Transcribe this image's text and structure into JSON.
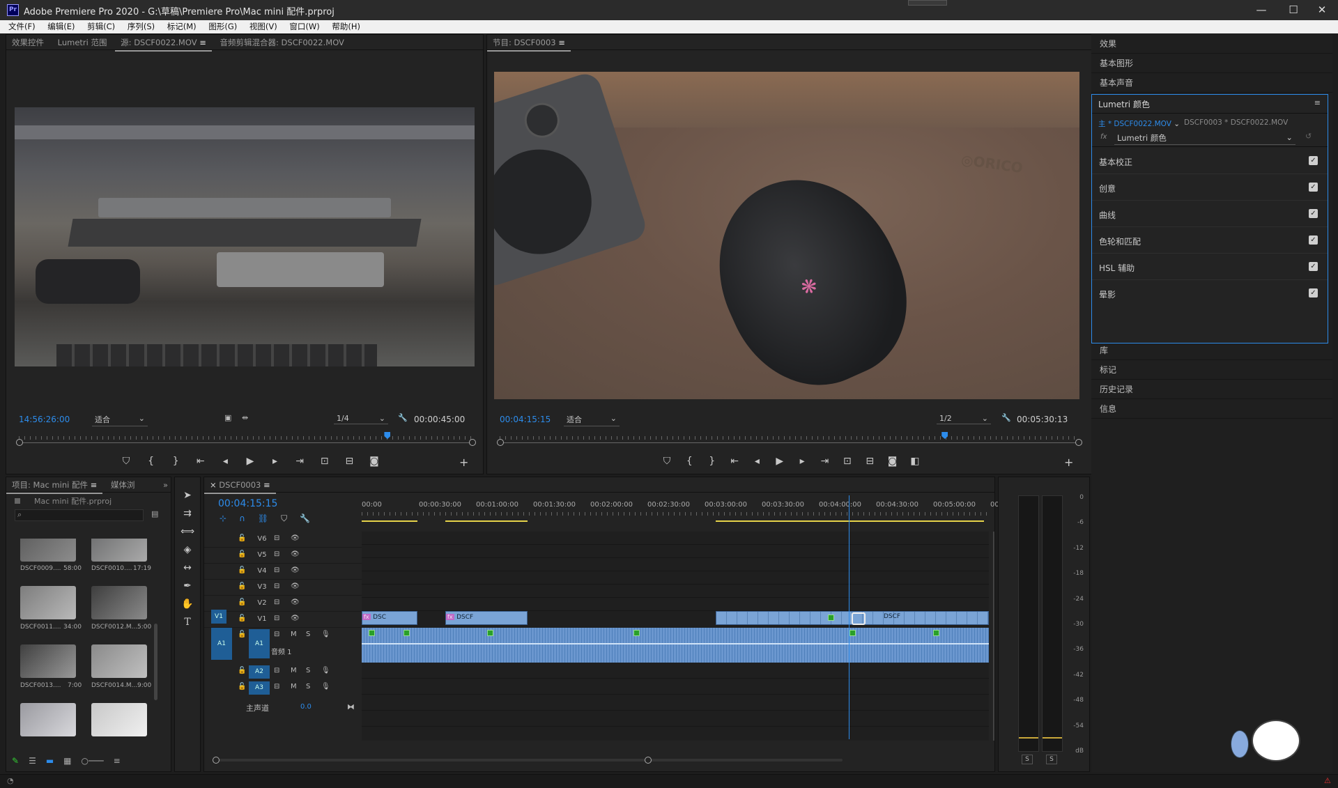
{
  "titlebar": {
    "title": "Adobe Premiere Pro 2020 - G:\\草稿\\Premiere Pro\\Mac mini 配件.prproj",
    "logo": "Pr",
    "min": "—",
    "max": "☐",
    "close": "✕"
  },
  "menu": [
    "文件(F)",
    "编辑(E)",
    "剪辑(C)",
    "序列(S)",
    "标记(M)",
    "图形(G)",
    "视图(V)",
    "窗口(W)",
    "帮助(H)"
  ],
  "source": {
    "tabs": [
      "效果控件",
      "Lumetri 范围",
      "源: DSCF0022.MOV",
      "音频剪辑混合器: DSCF0022.MOV"
    ],
    "timecode": "14:56:26:00",
    "fit": "适合",
    "quality": "1/4",
    "duration": "00:00:45:00",
    "playhead_fraction": 0.813
  },
  "program": {
    "tab": "节目: DSCF0003",
    "timecode": "00:04:15:15",
    "fit": "适合",
    "quality": "1/2",
    "duration": "00:05:30:13",
    "playhead_fraction": 0.769
  },
  "right": {
    "top_sections": [
      "效果",
      "基本图形",
      "基本声音"
    ],
    "lumetri_title": "Lumetri 颜色",
    "clip_selector": "主 * DSCF0022.MOV",
    "seq_clip": "DSCF0003 * DSCF0022.MOV",
    "fx_label": "fx",
    "effect_name": "Lumetri 颜色",
    "rows": [
      "基本校正",
      "创意",
      "曲线",
      "色轮和匹配",
      "HSL 辅助",
      "晕影"
    ],
    "bottom_sections": [
      "库",
      "标记",
      "历史记录",
      "信息"
    ]
  },
  "project": {
    "tab": "项目: Mac mini 配件",
    "tab2": "媒体浏",
    "file": "Mac mini 配件.prproj",
    "items": [
      {
        "name": "DSCF0009....",
        "dur": "58:00"
      },
      {
        "name": "DSCF0010....",
        "dur": "17:19"
      },
      {
        "name": "DSCF0011....",
        "dur": "34:00"
      },
      {
        "name": "DSCF0012.M...",
        "dur": "5:00"
      },
      {
        "name": "DSCF0013....",
        "dur": "7:00"
      },
      {
        "name": "DSCF0014.M...",
        "dur": "9:00"
      }
    ]
  },
  "timeline": {
    "tab": "DSCF0003",
    "timecode": "00:04:15:15",
    "ruler": [
      "00:00",
      "00:00:30:00",
      "00:01:00:00",
      "00:01:30:00",
      "00:02:00:00",
      "00:02:30:00",
      "00:03:00:00",
      "00:03:30:00",
      "00:04:00:00",
      "00:04:30:00",
      "00:05:00:00",
      "00:05"
    ],
    "video_tracks": [
      "V6",
      "V5",
      "V4",
      "V3",
      "V2",
      "V1"
    ],
    "audio_tracks": [
      "A1",
      "A2",
      "A3"
    ],
    "src_v": "V1",
    "src_a": "A1",
    "audio1_name": "音频 1",
    "master": "主声道",
    "master_val": "0.0",
    "m": "M",
    "s": "S",
    "clip_labels": [
      "DSC",
      "DSCF",
      "DSCF"
    ],
    "fx": "fx",
    "playhead_fraction": 0.777
  },
  "meter": {
    "scale": [
      "0",
      "-6",
      "-12",
      "-18",
      "-24",
      "-30",
      "-36",
      "-42",
      "-48",
      "-54",
      "dB"
    ],
    "solo": [
      "S",
      "S"
    ]
  },
  "status": {
    "warn": "⚠"
  }
}
